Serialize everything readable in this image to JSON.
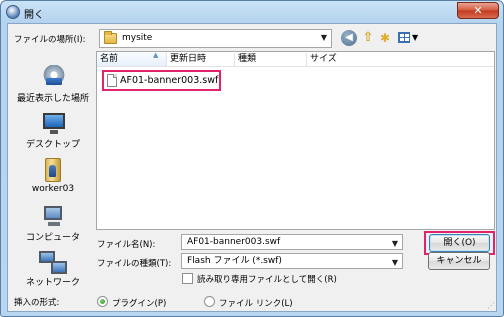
{
  "window": {
    "title": "開く",
    "close_glyph": "✕"
  },
  "lookin": {
    "label": "ファイルの場所(I):",
    "value": "mysite",
    "arrow": "▼"
  },
  "toolbar": {
    "back_glyph": "◀",
    "up_glyph": "⇧",
    "newfolder_glyph": "✱",
    "views_arrow": "▼"
  },
  "places": [
    {
      "label": "最近表示した場所",
      "icon": "recent-places-icon"
    },
    {
      "label": "デスクトップ",
      "icon": "desktop-icon"
    },
    {
      "label": "worker03",
      "icon": "user-folder-icon"
    },
    {
      "label": "コンピュータ",
      "icon": "computer-icon"
    },
    {
      "label": "ネットワーク",
      "icon": "network-icon"
    }
  ],
  "filelist": {
    "columns": [
      "名前",
      "更新日時",
      "種類",
      "サイズ"
    ],
    "sort_arrow": "▲",
    "files": [
      {
        "name": "AF01-banner003.swf"
      }
    ]
  },
  "filename": {
    "label": "ファイル名(N):",
    "value": "AF01-banner003.swf",
    "arrow": "▼"
  },
  "filetype": {
    "label": "ファイルの種類(T):",
    "value": "Flash ファイル (*.swf)",
    "arrow": "▼"
  },
  "readonly": {
    "label": "読み取り専用ファイルとして開く(R)",
    "checked": false
  },
  "buttons": {
    "open": "開く(O)",
    "cancel": "キャンセル"
  },
  "insert": {
    "label": "挿入の形式:",
    "options": [
      {
        "label": "プラグイン(P)",
        "selected": true
      },
      {
        "label": "ファイル リンク(L)",
        "selected": false
      }
    ]
  },
  "colors": {
    "highlight": "#e0236b",
    "title_gradient_top": "#c9e2f6",
    "close_red": "#c13a1c"
  }
}
